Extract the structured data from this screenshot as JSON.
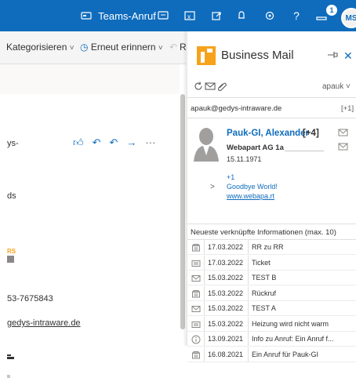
{
  "topbar": {
    "teams_call_label": "Teams-Anruf",
    "help_label": "?",
    "notification_count": "1",
    "avatar_initials": "MS",
    "background_color": "#0f6cbd"
  },
  "ribbon": {
    "categorize_label": "Kategorisieren",
    "remind_label": "Erneut erinnern",
    "truncated_label": "R"
  },
  "reading_pane": {
    "text_1": "ys-",
    "text_2": "ds",
    "logo_text": "RS",
    "text_3": "53-7675843",
    "text_4": "gedys-intraware.de",
    "actions": [
      "thumbs-up-icon",
      "reply-icon",
      "reply-all-icon",
      "forward-icon",
      "more-icon"
    ],
    "more_label": "···"
  },
  "addin": {
    "brand": "Business Mail",
    "brand_color": "#f7a21b",
    "user": "apauk",
    "email": "apauk@gedys-intraware.de",
    "email_more": "[+1]",
    "contact": {
      "name": "Pauk-GI, Alexander",
      "more": "[+4]",
      "company": "Webapart AG 1a",
      "birthday": "15.11.1971",
      "extra": "+1",
      "note": "Goodbye World!",
      "website": "www.webapa.rt"
    },
    "section_title": "Neueste verknüpfte Informationen (max. 10)",
    "items": [
      {
        "icon": "phone-icon",
        "date": "17.03.2022",
        "text": "RR zu RR"
      },
      {
        "icon": "ticket-icon",
        "date": "17.03.2022",
        "text": "Ticket"
      },
      {
        "icon": "mail-icon",
        "date": "15.03.2022",
        "text": "TEST B"
      },
      {
        "icon": "phone-icon",
        "date": "15.03.2022",
        "text": "Rückruf"
      },
      {
        "icon": "mail-icon",
        "date": "15.03.2022",
        "text": "TEST A"
      },
      {
        "icon": "ticket-icon",
        "date": "15.03.2022",
        "text": "Heizung wird nicht warm"
      },
      {
        "icon": "info-icon",
        "date": "13.09.2021",
        "text": "Info zu Anruf: Ein Anruf f..."
      },
      {
        "icon": "phone-icon",
        "date": "16.08.2021",
        "text": "Ein Anruf für Pauk-GI"
      }
    ]
  }
}
